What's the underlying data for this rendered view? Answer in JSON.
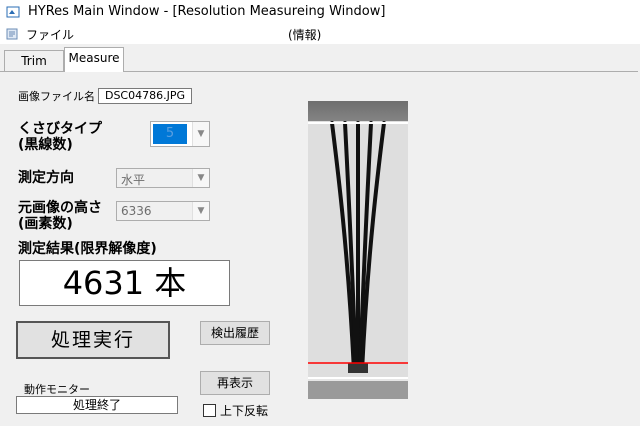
{
  "window": {
    "title": "HYRes Main Window - [Resolution Measureing Window]"
  },
  "menu": {
    "file": "ファイル",
    "info": "(情報)"
  },
  "tabs": [
    {
      "label": "Trim",
      "active": false
    },
    {
      "label": "Measure",
      "active": true
    }
  ],
  "file": {
    "label": "画像ファイル名",
    "value": "DSC04786.JPG"
  },
  "wedge_type": {
    "label_line1": "くさびタイプ",
    "label_line2": "(黒線数)",
    "value": "5"
  },
  "direction": {
    "label": "測定方向",
    "value": "水平"
  },
  "original_height": {
    "label_line1": "元画像の高さ",
    "label_line2": "(画素数)",
    "value": "6336"
  },
  "result": {
    "label": "測定結果(限界解像度)",
    "value": "4631 本"
  },
  "buttons": {
    "execute": "処理実行",
    "history": "検出履歴",
    "redisplay": "再表示"
  },
  "monitor": {
    "label": "動作モニター",
    "value": "処理終了"
  },
  "flip": {
    "label": "上下反転",
    "checked": false
  },
  "colors": {
    "accent": "#0078d7",
    "red_line": "#ff0000",
    "white_line": "#ffffff"
  }
}
